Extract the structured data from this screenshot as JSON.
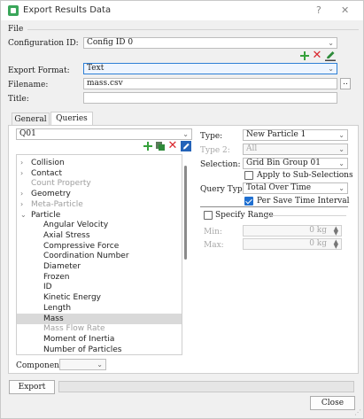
{
  "window": {
    "title": "Export Results Data",
    "help_label": "?",
    "close_label": "✕",
    "icon": "app-icon"
  },
  "file_group": {
    "title": "File",
    "configuration_id_label": "Configuration ID:",
    "configuration_id_value": "Config ID 0",
    "export_format_label": "Export Format:",
    "export_format_value": "Text",
    "filename_label": "Filename:",
    "filename_value": "mass.csv",
    "browse_label": "..",
    "title_label": "Title:",
    "title_value": ""
  },
  "tabs": [
    {
      "label": "General",
      "active": false
    },
    {
      "label": "Queries",
      "active": true
    }
  ],
  "queries": {
    "query_select_value": "Q01",
    "tree_items": [
      {
        "label": "Collision",
        "level": 0,
        "expander": "›",
        "disabled": false,
        "selected": false
      },
      {
        "label": "Contact",
        "level": 0,
        "expander": "›",
        "disabled": false,
        "selected": false
      },
      {
        "label": "Count Property",
        "level": 1,
        "expander": "",
        "disabled": true,
        "selected": false
      },
      {
        "label": "Geometry",
        "level": 0,
        "expander": "›",
        "disabled": false,
        "selected": false
      },
      {
        "label": "Meta-Particle",
        "level": 0,
        "expander": "›",
        "disabled": true,
        "selected": false
      },
      {
        "label": "Particle",
        "level": 0,
        "expander": "⌄",
        "disabled": false,
        "selected": false
      },
      {
        "label": "Angular Velocity",
        "level": 2,
        "expander": "",
        "disabled": false,
        "selected": false
      },
      {
        "label": "Axial Stress",
        "level": 2,
        "expander": "",
        "disabled": false,
        "selected": false
      },
      {
        "label": "Compressive Force",
        "level": 2,
        "expander": "",
        "disabled": false,
        "selected": false
      },
      {
        "label": "Coordination Number",
        "level": 2,
        "expander": "",
        "disabled": false,
        "selected": false
      },
      {
        "label": "Diameter",
        "level": 2,
        "expander": "",
        "disabled": false,
        "selected": false
      },
      {
        "label": "Frozen",
        "level": 2,
        "expander": "",
        "disabled": false,
        "selected": false
      },
      {
        "label": "ID",
        "level": 2,
        "expander": "",
        "disabled": false,
        "selected": false
      },
      {
        "label": "Kinetic Energy",
        "level": 2,
        "expander": "",
        "disabled": false,
        "selected": false
      },
      {
        "label": "Length",
        "level": 2,
        "expander": "",
        "disabled": false,
        "selected": false
      },
      {
        "label": "Mass",
        "level": 2,
        "expander": "",
        "disabled": false,
        "selected": true
      },
      {
        "label": "Mass Flow Rate",
        "level": 2,
        "expander": "",
        "disabled": true,
        "selected": false
      },
      {
        "label": "Moment of Inertia",
        "level": 2,
        "expander": "",
        "disabled": false,
        "selected": false
      },
      {
        "label": "Number of Particles",
        "level": 2,
        "expander": "",
        "disabled": false,
        "selected": false
      }
    ],
    "component_label": "Component:",
    "component_value": ""
  },
  "options": {
    "type_label": "Type:",
    "type_value": "New Particle 1",
    "type2_label": "Type 2:",
    "type2_value": "All",
    "selection_label": "Selection:",
    "selection_value": "Grid Bin Group 01",
    "apply_subselections_label": "Apply to Sub-Selections",
    "apply_subselections_checked": false,
    "query_type_label": "Query Type:",
    "query_type_value": "Total Over Time",
    "per_save_label": "Per Save Time Interval",
    "per_save_checked": true,
    "specify_range_label": "Specify Range",
    "specify_range_checked": false,
    "min_label": "Min:",
    "min_value": "0 kg",
    "max_label": "Max:",
    "max_value": "0 kg"
  },
  "footer": {
    "export_label": "Export",
    "export_progress": 0,
    "close_label": "Close"
  },
  "colors": {
    "accent": "#1f6fd0",
    "add_green": "#36a13c",
    "delete_red": "#d9272e"
  }
}
